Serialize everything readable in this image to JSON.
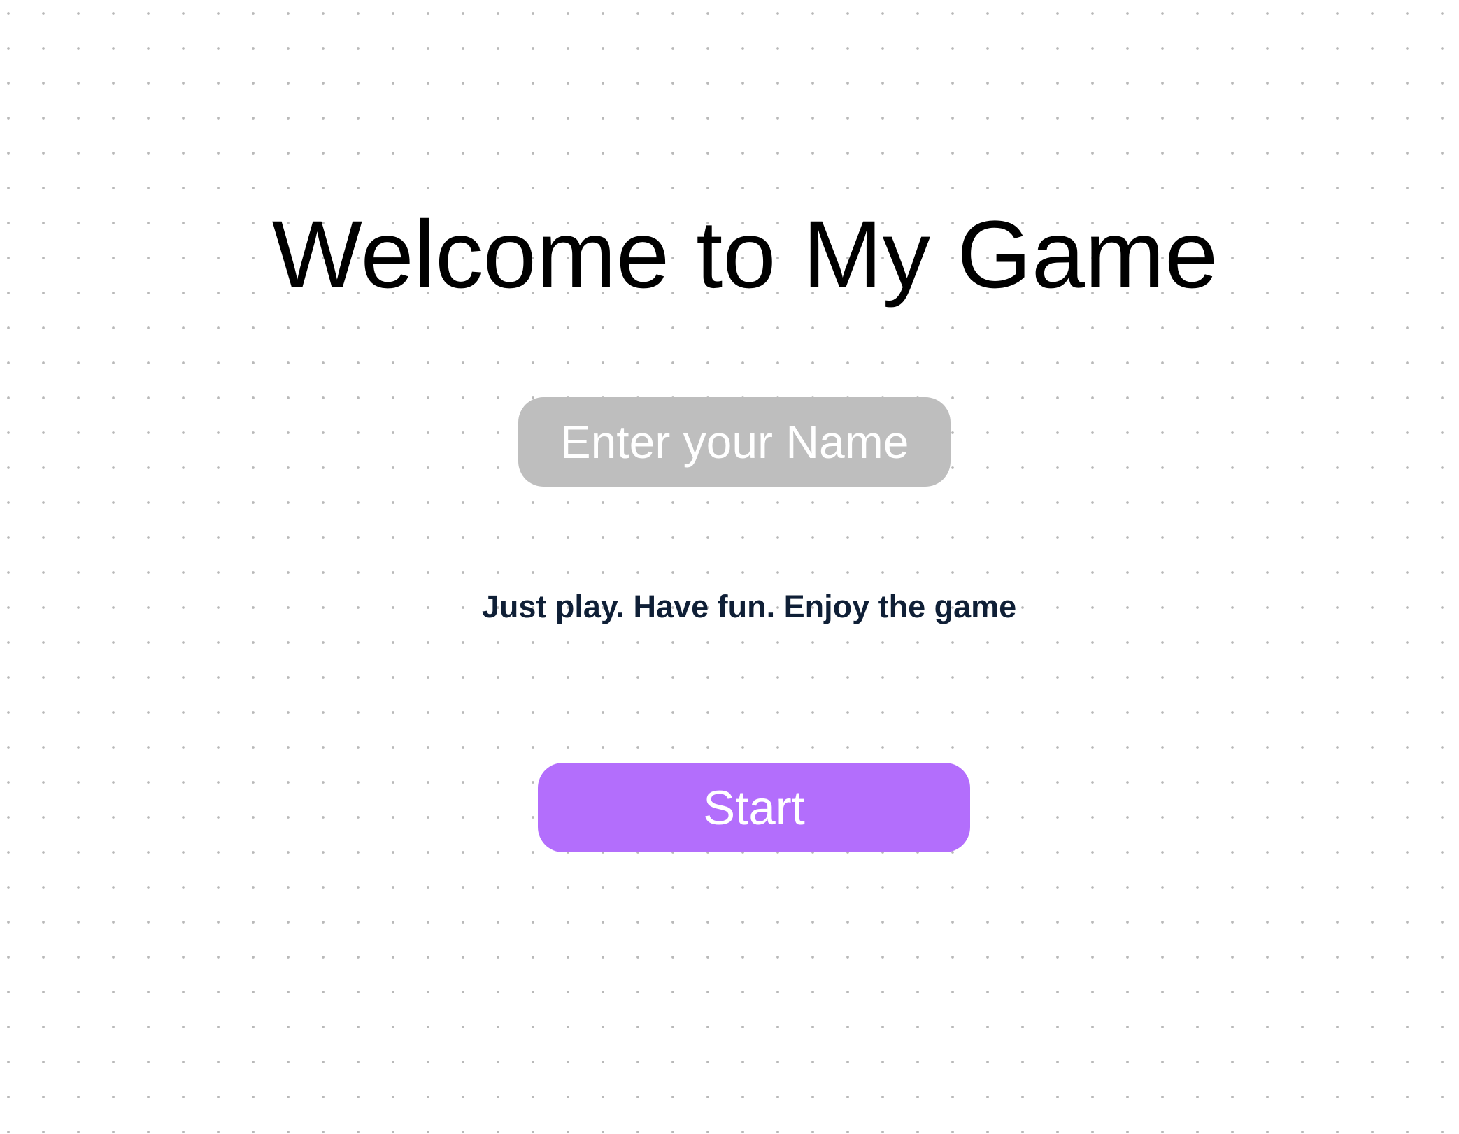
{
  "app": {
    "title": "Welcome to My Game",
    "name_input": {
      "placeholder": "Enter your Name",
      "value": ""
    },
    "tagline": "Just play. Have fun. Enjoy the game",
    "start_label": "Start"
  },
  "colors": {
    "background": "#ffffff",
    "dot_grid": "#b9b9b9",
    "title_text": "#000000",
    "input_background": "#bebebe",
    "input_text": "#ffffff",
    "tagline_text": "#0f1f36",
    "start_button_background": "#b36efc",
    "start_button_text": "#ffffff"
  }
}
